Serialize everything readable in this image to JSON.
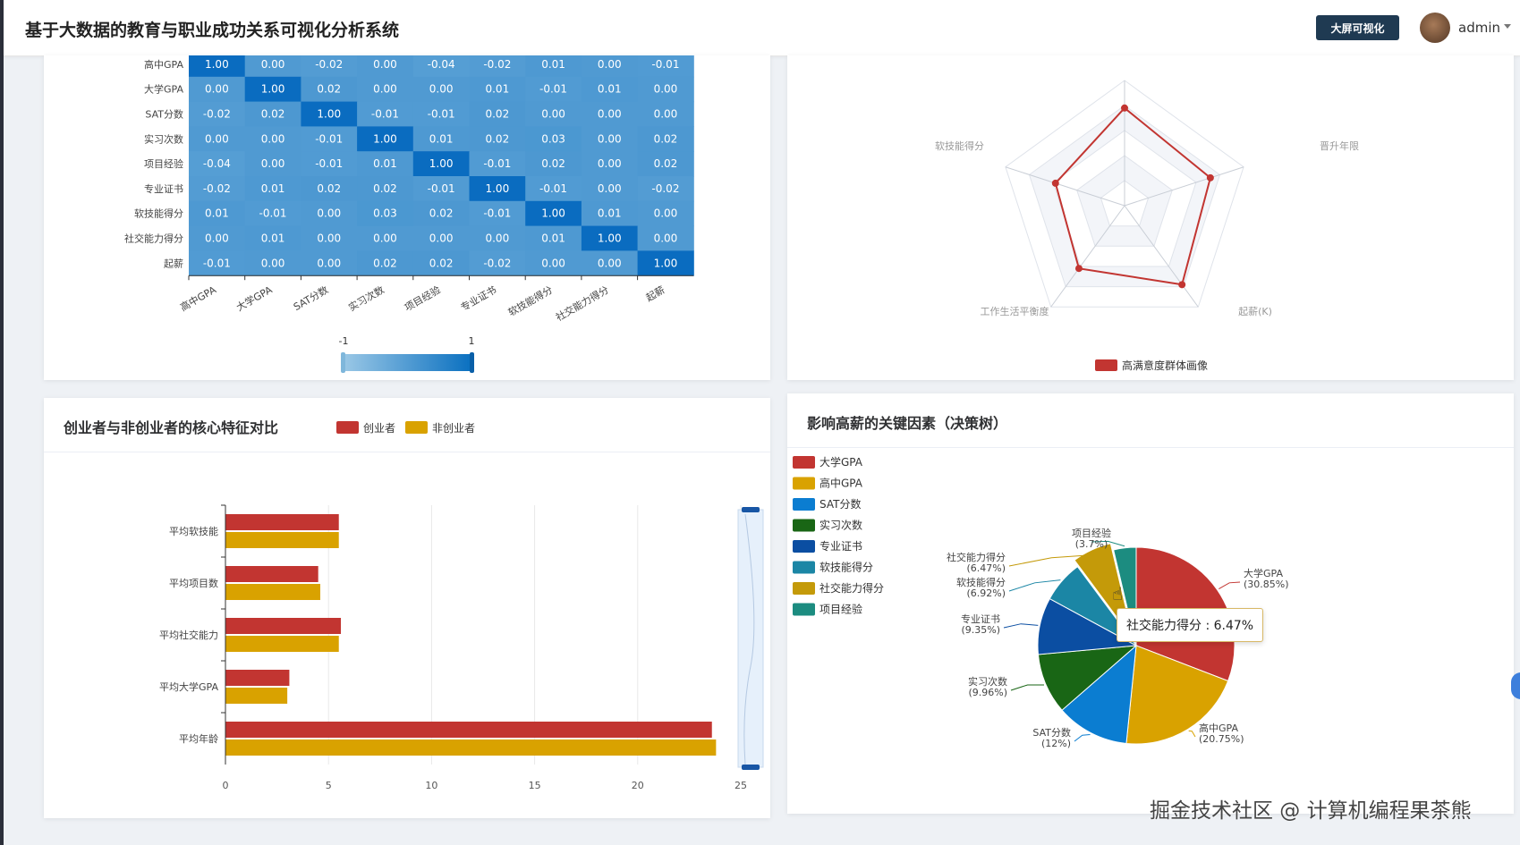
{
  "header": {
    "title": "基于大数据的教育与职业成功关系可视化分析系统",
    "screen_button": "大屏可视化",
    "user": "admin"
  },
  "watermark": "掘金技术社区 @ 计算机编程果茶熊",
  "heatmap_card": {
    "visualmap_min": "-1",
    "visualmap_max": "1"
  },
  "radar_card": {
    "legend": "高满意度群体画像"
  },
  "bar_card": {
    "title": "创业者与非创业者的核心特征对比"
  },
  "pie_card": {
    "title": "影响高薪的关键因素（决策树）",
    "tooltip": "社交能力得分 : 6.47%"
  },
  "colors": {
    "red": "#c23531",
    "gold": "#d9a200",
    "blue": "#0b7dd1",
    "green": "#196615",
    "navy": "#0b4ea2",
    "teal": "#1b86a5",
    "olive": "#c49a09",
    "cyan": "#1c8c80"
  },
  "chart_data": [
    {
      "type": "heatmap",
      "labels": [
        "高中GPA",
        "大学GPA",
        "SAT分数",
        "实习次数",
        "项目经验",
        "专业证书",
        "软技能得分",
        "社交能力得分",
        "起薪"
      ],
      "matrix": [
        [
          "1.00",
          "0.00",
          "-0.02",
          "0.00",
          "-0.04",
          "-0.02",
          "0.01",
          "0.00",
          "-0.01"
        ],
        [
          "0.00",
          "1.00",
          "0.02",
          "0.00",
          "0.00",
          "0.01",
          "-0.01",
          "0.01",
          "0.00"
        ],
        [
          "-0.02",
          "0.02",
          "1.00",
          "-0.01",
          "-0.01",
          "0.02",
          "0.00",
          "0.00",
          "0.00"
        ],
        [
          "0.00",
          "0.00",
          "-0.01",
          "1.00",
          "0.01",
          "0.02",
          "0.03",
          "0.00",
          "0.02"
        ],
        [
          "-0.04",
          "0.00",
          "-0.01",
          "0.01",
          "1.00",
          "-0.01",
          "0.02",
          "0.00",
          "0.02"
        ],
        [
          "-0.02",
          "0.01",
          "0.02",
          "0.02",
          "-0.01",
          "1.00",
          "-0.01",
          "0.00",
          "-0.02"
        ],
        [
          "0.01",
          "-0.01",
          "0.00",
          "0.03",
          "0.02",
          "-0.01",
          "1.00",
          "0.01",
          "0.00"
        ],
        [
          "0.00",
          "0.01",
          "0.00",
          "0.00",
          "0.00",
          "0.00",
          "0.01",
          "1.00",
          "0.00"
        ],
        [
          "-0.01",
          "0.00",
          "0.00",
          "0.02",
          "0.02",
          "-0.02",
          "0.00",
          "0.00",
          "1.00"
        ]
      ],
      "range": [
        -1,
        1
      ]
    },
    {
      "type": "radar",
      "indicators": [
        "软技能得分",
        "晋升年限",
        "起薪(K)",
        "工作生活平衡度",
        ""
      ],
      "series": [
        {
          "name": "高满意度群体画像",
          "values": [
            0.78,
            0.72,
            0.78,
            0.62,
            0.58
          ]
        }
      ]
    },
    {
      "type": "bar",
      "categories": [
        "平均软技能",
        "平均项目数",
        "平均社交能力",
        "平均大学GPA",
        "平均年龄"
      ],
      "series": [
        {
          "name": "创业者",
          "values": [
            5.5,
            4.5,
            5.6,
            3.1,
            23.6
          ]
        },
        {
          "name": "非创业者",
          "values": [
            5.5,
            4.6,
            5.5,
            3.0,
            23.8
          ]
        }
      ],
      "xlim": [
        0,
        25
      ],
      "xticks": [
        "0",
        "5",
        "10",
        "15",
        "20",
        "25"
      ]
    },
    {
      "type": "pie",
      "slices": [
        {
          "name": "大学GPA",
          "value": 30.85,
          "label": "(30.85%)"
        },
        {
          "name": "高中GPA",
          "value": 20.75,
          "label": "(20.75%)"
        },
        {
          "name": "SAT分数",
          "value": 12,
          "label": "(12%)"
        },
        {
          "name": "实习次数",
          "value": 9.96,
          "label": "(9.96%)"
        },
        {
          "name": "专业证书",
          "value": 9.35,
          "label": "(9.35%)"
        },
        {
          "name": "软技能得分",
          "value": 6.92,
          "label": "(6.92%)"
        },
        {
          "name": "社交能力得分",
          "value": 6.47,
          "label": "(6.47%)"
        },
        {
          "name": "项目经验",
          "value": 3.7,
          "label": "(3.7%)"
        }
      ]
    }
  ]
}
